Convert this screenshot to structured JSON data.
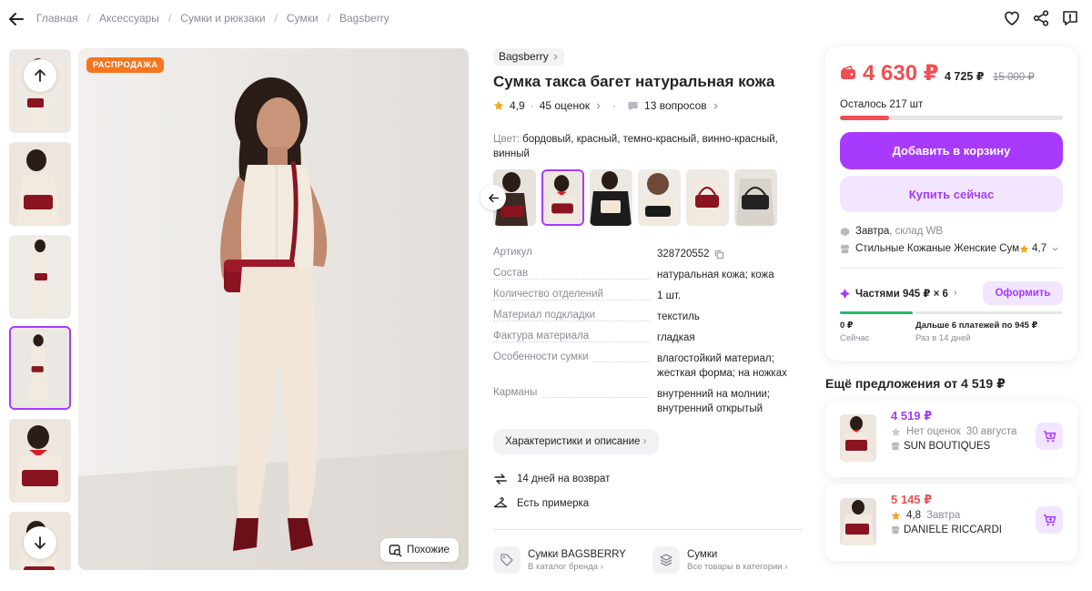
{
  "breadcrumbs": [
    "Главная",
    "Аксессуары",
    "Сумки и рюкзаки",
    "Сумки",
    "Bagsberry"
  ],
  "gallery": {
    "badge": "РАСПРОДАЖА",
    "similar_label": "Похожие"
  },
  "product": {
    "brand": "Bagsberry",
    "title": "Сумка такса багет натуральная кожа",
    "rating": "4,9",
    "reviews": "45 оценок",
    "questions": "13 вопросов",
    "color_label": "Цвет:",
    "color_value": "бордовый, красный, темно-красный, винно-красный, винный"
  },
  "specs": [
    {
      "key": "Артикул",
      "value": "328720552"
    },
    {
      "key": "Состав",
      "value": "натуральная кожа; кожа"
    },
    {
      "key": "Количество отделений",
      "value": "1 шт."
    },
    {
      "key": "Материал подкладки",
      "value": "текстиль"
    },
    {
      "key": "Фактура материала",
      "value": "гладкая"
    },
    {
      "key": "Особенности сумки",
      "value": "влагостойкий материал; жесткая форма; на ножках"
    },
    {
      "key": "Карманы",
      "value": "внутренний на молнии; внутренний открытый"
    }
  ],
  "characteristics_button": "Характеристики и описание",
  "features": {
    "return": "14 дней на возврат",
    "fitting": "Есть примерка"
  },
  "links": {
    "brand_title": "Сумки BAGSBERRY",
    "brand_sub": "В каталог бренда",
    "cat_title": "Сумки",
    "cat_sub": "Все товары в категории"
  },
  "price": {
    "current": "4 630 ₽",
    "second": "4 725 ₽",
    "old": "15 000 ₽",
    "left_text": "Осталось 217 шт",
    "stock_fraction": 0.22,
    "add_to_cart": "Добавить в корзину",
    "buy_now": "Купить сейчас",
    "delivery_when": "Завтра",
    "delivery_where": ", склад WB",
    "seller": "Стильные Кожаные Женские Сум",
    "seller_rating": "4,7",
    "parts_label": "Частями 945 ₽ × 6",
    "parts_button": "Оформить",
    "parts_now_amount": "0 ₽",
    "parts_now_label": "Сейчас",
    "parts_later_amount": "Дальше 6 платежей по 945 ₽",
    "parts_later_label": "Раз в 14 дней"
  },
  "more_offers": {
    "title": "Ещё предложения от 4 519 ₽",
    "items": [
      {
        "price": "4 519 ₽",
        "rating": "Нет оценок",
        "date": "30 августа",
        "shop": "SUN BOUTIQUES"
      },
      {
        "price": "5 145 ₽",
        "rating": "4,8",
        "date": "Завтра",
        "shop": "DANIELE RICCARDI"
      }
    ]
  },
  "colors": {
    "accent": "#a73afd",
    "accent_light": "#f2e6ff",
    "price_red": "#f04f54",
    "sale_orange": "#f5761f",
    "bag_red": "#8a1420"
  }
}
